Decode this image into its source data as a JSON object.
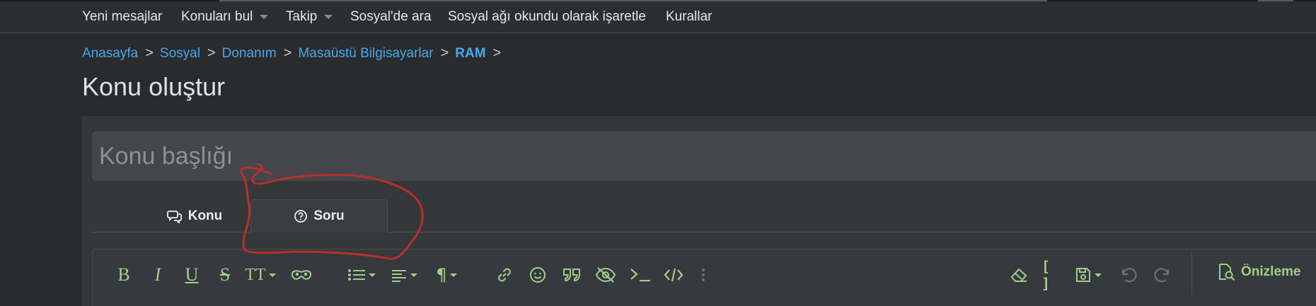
{
  "nav": {
    "items": [
      {
        "label": "Yeni mesajlar",
        "dropdown": false
      },
      {
        "label": "Konuları bul",
        "dropdown": true
      },
      {
        "label": "Takip",
        "dropdown": true
      },
      {
        "label": "Sosyal'de ara",
        "dropdown": false
      },
      {
        "label": "Sosyal ağı okundu olarak işaretle",
        "dropdown": false
      },
      {
        "label": "Kurallar",
        "dropdown": false
      }
    ]
  },
  "breadcrumb": {
    "items": [
      "Anasayfa",
      "Sosyal",
      "Donanım",
      "Masaüstü Bilgisayarlar",
      "RAM"
    ],
    "separator": ">"
  },
  "page": {
    "title": "Konu oluştur"
  },
  "form": {
    "title_placeholder": "Konu başlığı",
    "title_value": "",
    "tabs": [
      {
        "label": "Konu",
        "icon": "comments-icon",
        "active": false
      },
      {
        "label": "Soru",
        "icon": "question-circle-icon",
        "active": true
      }
    ]
  },
  "toolbar": {
    "buttons": [
      "bold-icon",
      "italic-icon",
      "underline-icon",
      "strikethrough-icon",
      "text-size-icon",
      "spoiler-mask-icon",
      "list-icon",
      "align-icon",
      "paragraph-icon",
      "link-icon",
      "smiley-icon",
      "quote-icon",
      "hide-eye-icon",
      "code-inline-icon",
      "code-block-icon",
      "more-vertical-icon",
      "eraser-icon",
      "brackets-icon",
      "save-draft-icon",
      "undo-icon",
      "redo-icon"
    ],
    "text_glyphs": {
      "bold": "B",
      "italic": "I",
      "underline": "U",
      "strike": "S",
      "text_size": "TT",
      "paragraph": "¶",
      "brackets": "[ ]"
    },
    "preview_label": "Önizleme"
  },
  "colors": {
    "background": "#2a2b2d",
    "accent_link": "#47a7eb",
    "toolbar_icon": "#9fcf8a",
    "annotation": "#b8302c"
  }
}
